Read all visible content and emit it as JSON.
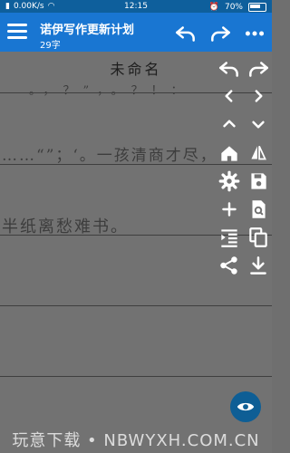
{
  "status": {
    "speed": "0.00K/s",
    "time": "12:15",
    "battery": "70%"
  },
  "appbar": {
    "title": "诺伊写作更新计划",
    "word_count": "29字"
  },
  "doc": {
    "title": "未命名",
    "handwriting": [
      {
        "text": "。，？”，。？！："
      },
      {
        "text": "……“”；‘。一孩清商才尽，"
      },
      {
        "text": "半纸离愁难书。"
      }
    ]
  },
  "watermark": "玩意下载 • NBWYXH.COM.CN",
  "colors": {
    "appbar": "#1976d2",
    "statusbar": "#0e5f9c",
    "paper": "#727272",
    "fab": "#0e5e95"
  }
}
